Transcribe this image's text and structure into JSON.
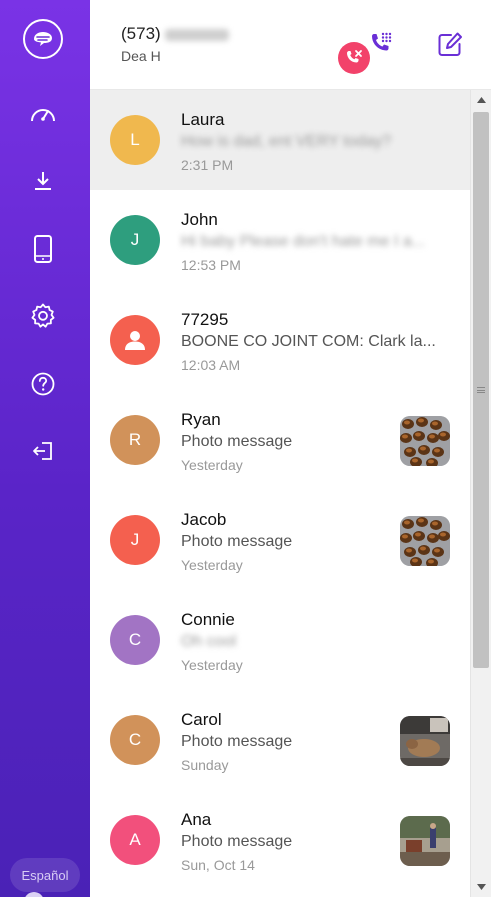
{
  "sidebar": {
    "icons": [
      {
        "name": "speedometer-icon"
      },
      {
        "name": "download-icon"
      },
      {
        "name": "phone-device-icon"
      },
      {
        "name": "settings-icon"
      },
      {
        "name": "help-icon"
      },
      {
        "name": "logout-icon"
      }
    ],
    "language_label": "Español"
  },
  "header": {
    "phone_prefix": "(573)",
    "owner_name": "Dea H"
  },
  "conversations": [
    {
      "initial": "L",
      "name": "Laura",
      "preview": "How is dad, ent VERY today?",
      "preview_blurred": true,
      "time": "2:31 PM",
      "avatar_color": "#f0b84e",
      "thumb": null,
      "selected": true
    },
    {
      "initial": "J",
      "name": "John",
      "preview": "Hi baby Please don't hate me I a...",
      "preview_blurred": true,
      "time": "12:53 PM",
      "avatar_color": "#2e9e7e",
      "thumb": null,
      "selected": false
    },
    {
      "initial": "",
      "name": "77295",
      "preview": "BOONE CO JOINT COM: Clark la...",
      "preview_blurred": false,
      "time": "12:03 AM",
      "avatar_color": "#f4604f",
      "thumb": null,
      "selected": false,
      "person_icon": true
    },
    {
      "initial": "R",
      "name": "Ryan",
      "preview": "Photo message",
      "preview_blurred": false,
      "time": "Yesterday",
      "avatar_color": "#d1925a",
      "thumb": "cookies",
      "selected": false
    },
    {
      "initial": "J",
      "name": "Jacob",
      "preview": "Photo message",
      "preview_blurred": false,
      "time": "Yesterday",
      "avatar_color": "#f4604f",
      "thumb": "cookies",
      "selected": false
    },
    {
      "initial": "C",
      "name": "Connie",
      "preview": "Oh cool",
      "preview_blurred": true,
      "time": "Yesterday",
      "avatar_color": "#a274c4",
      "thumb": null,
      "selected": false
    },
    {
      "initial": "C",
      "name": "Carol",
      "preview": "Photo message",
      "preview_blurred": false,
      "time": "Sunday",
      "avatar_color": "#d1925a",
      "thumb": "dog",
      "selected": false
    },
    {
      "initial": "A",
      "name": "Ana",
      "preview": "Photo message",
      "preview_blurred": false,
      "time": "Sun, Oct 14",
      "avatar_color": "#f2507c",
      "thumb": "outdoor",
      "selected": false
    }
  ],
  "colors": {
    "sidebar_top": "#7a33e6",
    "sidebar_bottom": "#4a22b6",
    "accent_purple": "#6a2fd6",
    "hangup_red": "#f2426a"
  }
}
